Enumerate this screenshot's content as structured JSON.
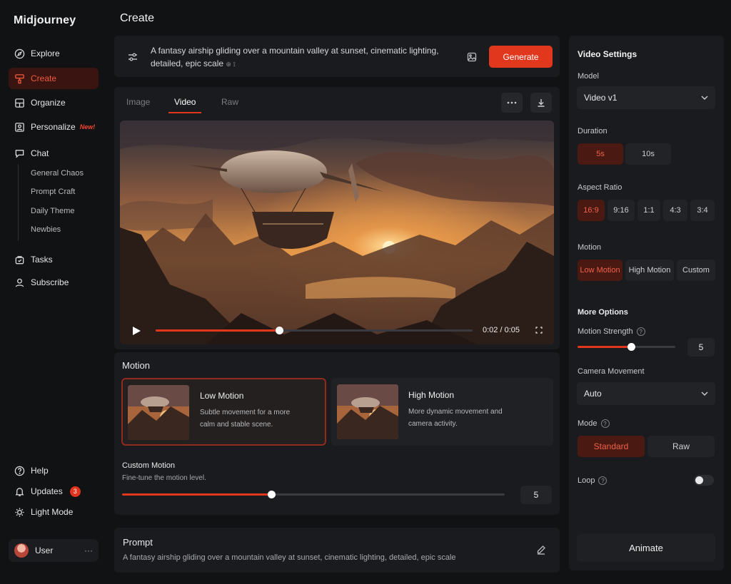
{
  "app": {
    "name": "Midjourney"
  },
  "sidebar": {
    "items": [
      {
        "label": "Explore",
        "icon": "compass-icon"
      },
      {
        "label": "Create",
        "icon": "brush-icon"
      },
      {
        "label": "Organize",
        "icon": "organize-icon"
      },
      {
        "label": "Personalize",
        "icon": "personalize-icon",
        "badge": "New!"
      },
      {
        "label": "Chat",
        "icon": "chat-icon"
      }
    ],
    "chat_rooms": [
      "General Chaos",
      "Prompt Craft",
      "Daily Theme",
      "Newbies"
    ],
    "more": [
      {
        "label": "Tasks",
        "icon": "tasks-icon"
      },
      {
        "label": "Subscribe",
        "icon": "subscribe-icon"
      }
    ],
    "bottom": [
      {
        "label": "Help",
        "icon": "help-icon"
      },
      {
        "label": "Updates",
        "icon": "bell-icon",
        "count": "3"
      },
      {
        "label": "Light Mode",
        "icon": "sun-icon"
      }
    ],
    "user": {
      "name": "User",
      "menu": "···"
    }
  },
  "main": {
    "title": "Create",
    "prompt_bar": {
      "text": "A fantasy airship gliding over a mountain valley at sunset, cinematic lighting, detailed, epic scale",
      "suffix": "⊕ ⟟",
      "generate_label": "Generate"
    },
    "tabs": [
      {
        "label": "Image"
      },
      {
        "label": "Video",
        "active": true
      },
      {
        "label": "Raw"
      }
    ],
    "player": {
      "time": "0:02 / 0:05",
      "progress": 0.39
    },
    "motion": {
      "heading": "Motion",
      "cards": [
        {
          "title": "Low Motion",
          "desc": "Subtle movement for a more calm and stable scene.",
          "selected": true
        },
        {
          "title": "High Motion",
          "desc": "More dynamic movement and camera activity.",
          "selected": false
        }
      ],
      "custom": {
        "title": "Custom Motion",
        "desc": "Fine-tune the motion level.",
        "value": "5",
        "level": 0.39
      }
    },
    "prompt": {
      "heading": "Prompt",
      "text": "A fantasy airship gliding over a mountain valley at sunset, cinematic lighting, detailed, epic scale"
    }
  },
  "settings": {
    "title": "Video Settings",
    "model": {
      "label": "Model",
      "value": "Video v1"
    },
    "duration": {
      "label": "Duration",
      "options": [
        "5s",
        "10s"
      ],
      "selected": "5s"
    },
    "aspect": {
      "label": "Aspect Ratio",
      "options": [
        "16:9",
        "9:16",
        "1:1",
        "4:3",
        "3:4"
      ],
      "selected": "16:9"
    },
    "motion": {
      "label": "Motion",
      "options": [
        "Low Motion",
        "High Motion",
        "Custom"
      ],
      "selected": "Low Motion"
    },
    "more_options": "More Options",
    "motion_strength": {
      "label": "Motion Strength",
      "value": "5",
      "level": 0.55
    },
    "camera": {
      "label": "Camera Movement",
      "value": "Auto"
    },
    "mode": {
      "label": "Mode",
      "options": [
        "Standard",
        "Raw"
      ],
      "selected": "Standard"
    },
    "loop": {
      "label": "Loop",
      "on": false
    },
    "animate_label": "Animate"
  },
  "colors": {
    "accent": "#e0371d",
    "background": "#111214",
    "panel": "#1a1b1e"
  }
}
